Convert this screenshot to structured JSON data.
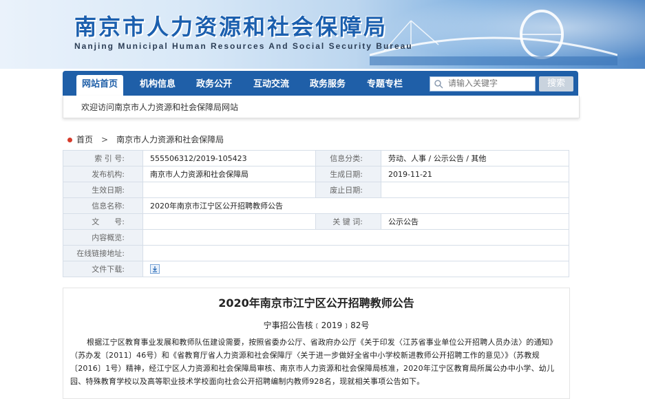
{
  "header": {
    "title_cn": "南京市人力资源和社会保障局",
    "title_en": "Nanjing Municipal Human Resources And Social Security Bureau"
  },
  "nav": {
    "items": [
      {
        "label": "网站首页",
        "active": true
      },
      {
        "label": "机构信息",
        "active": false
      },
      {
        "label": "政务公开",
        "active": false
      },
      {
        "label": "互动交流",
        "active": false
      },
      {
        "label": "政务服务",
        "active": false
      },
      {
        "label": "专题专栏",
        "active": false
      }
    ],
    "search_placeholder": "请输入关键字",
    "search_button": "搜索"
  },
  "welcome": "欢迎访问南京市人力资源和社会保障局网站",
  "breadcrumb": {
    "home": "首页",
    "separator": ">",
    "current": "南京市人力资源和社会保障局"
  },
  "meta": {
    "index_label": "索 引 号:",
    "index_value": "555506312/2019-105423",
    "category_label": "信息分类:",
    "category_value": "劳动、人事 / 公示公告 / 其他",
    "publisher_label": "发布机构:",
    "publisher_value": "南京市人力资源和社会保障局",
    "created_label": "生成日期:",
    "created_value": "2019-11-21",
    "effective_label": "生效日期:",
    "effective_value": "",
    "expiry_label": "废止日期:",
    "expiry_value": "",
    "name_label": "信息名称:",
    "name_value": "2020年南京市江宁区公开招聘教师公告",
    "docno_label": "文　　号:",
    "docno_value": "",
    "keyword_label": "关 键 词:",
    "keyword_value": "公示公告",
    "summary_label": "内容概览:",
    "summary_value": "",
    "link_label": "在线链接地址:",
    "link_value": "",
    "download_label": "文件下载:"
  },
  "article": {
    "title": "2020年南京市江宁区公开招聘教师公告",
    "doc_no": "宁事招公告核﹝2019﹞82号",
    "body": "根据江宁区教育事业发展和教师队伍建设需要，按照省委办公厅、省政府办公厅《关于印发〈江苏省事业单位公开招聘人员办法〉的通知》（苏办发〔2011〕46号）和《省教育厅省人力资源和社会保障厅〈关于进一步做好全省中小学校新进教师公开招聘工作的意见〉》（苏教规〔2016〕1号）精神，经江宁区人力资源和社会保障局审核、南京市人力资源和社会保障局核准，2020年江宁区教育局所属公办中小学、幼儿园、特殊教育学校以及高等职业技术学校面向社会公开招聘编制内教师928名，现就相关事项公告如下。"
  }
}
